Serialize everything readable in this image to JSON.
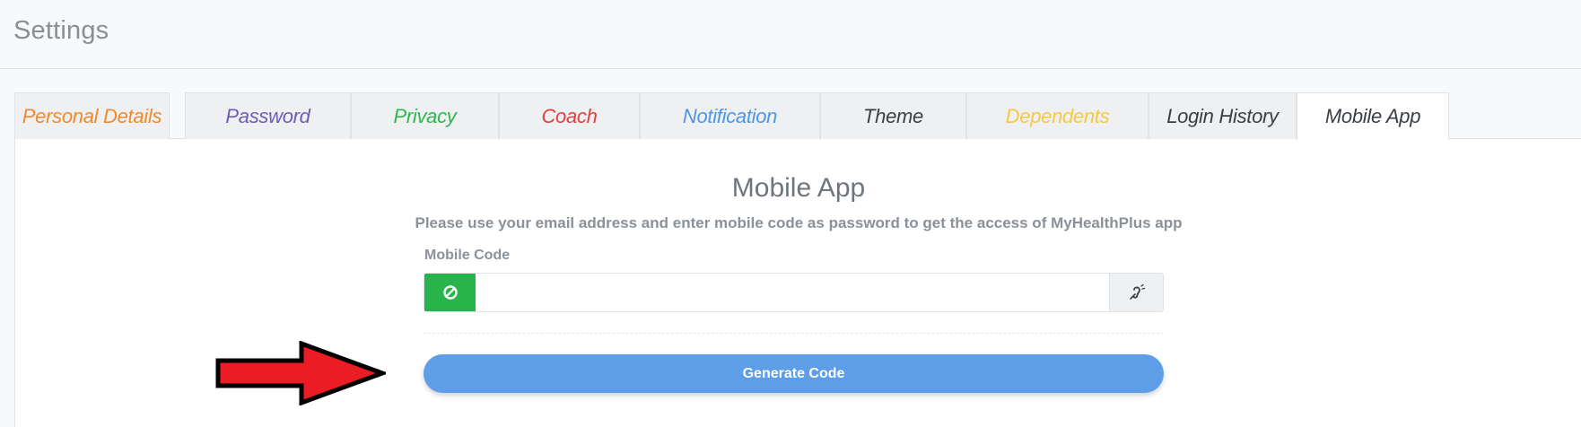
{
  "header": {
    "title": "Settings"
  },
  "tabs": [
    {
      "label": "Personal Details",
      "color": "#f28a2b"
    },
    {
      "label": "Password",
      "color": "#6f5bb5"
    },
    {
      "label": "Privacy",
      "color": "#2db84d"
    },
    {
      "label": "Coach",
      "color": "#e2403d"
    },
    {
      "label": "Notification",
      "color": "#4e97e4"
    },
    {
      "label": "Theme",
      "color": "#3a3f44"
    },
    {
      "label": "Dependents",
      "color": "#f6c945"
    },
    {
      "label": "Login History",
      "color": "#3a3f44"
    },
    {
      "label": "Mobile App",
      "color": "#3a3f44"
    }
  ],
  "active_tab": "Mobile App",
  "panel": {
    "title": "Mobile App",
    "description": "Please use your email address and enter mobile code as password to get the access of MyHealthPlus app",
    "field_label": "Mobile Code",
    "field_value": "",
    "left_icon": "ban-icon",
    "right_icon": "hearing-assist-icon",
    "button_label": "Generate Code"
  },
  "annotation": {
    "icon": "red-arrow-icon",
    "color": "#ec1c24"
  },
  "colors": {
    "accent_green": "#27b44b",
    "button_blue": "#5e9ee9"
  }
}
